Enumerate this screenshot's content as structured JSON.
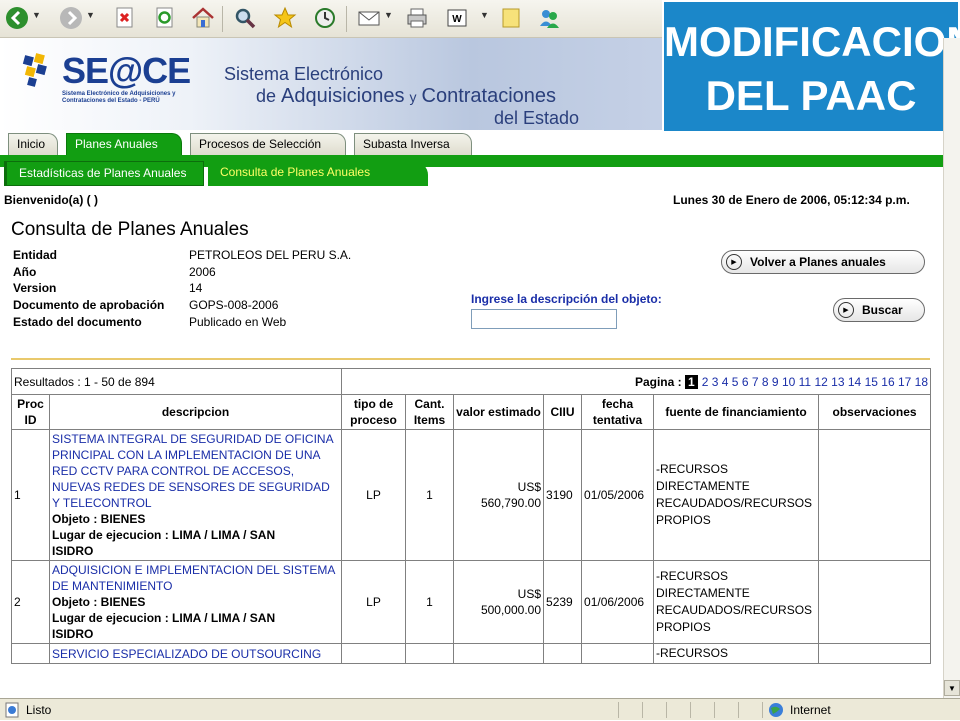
{
  "toolbar": {
    "buttons": [
      "back-icon",
      "forward-icon",
      "stop-icon",
      "refresh-icon",
      "home-icon",
      "search-icon",
      "favorites-icon",
      "history-icon",
      "mail-icon",
      "print-icon",
      "edit-icon",
      "discuss-icon",
      "messenger-icon"
    ]
  },
  "banner": {
    "logo": "SE@CE",
    "logo_sub": "Sistema Electrónico de Adquisiciones y Contrataciones del Estado - PERÚ",
    "title_line1": "Sistema Electrónico",
    "title_line2a": "de",
    "title_line2b": "Adquisiciones",
    "title_line2c": "y",
    "title_line2d": "Contrataciones",
    "title_line3": "del Estado"
  },
  "overlay": {
    "line1": "MODIFICACION",
    "line2": "DEL PAAC"
  },
  "tabs": [
    "Inicio",
    "Planes Anuales",
    "Procesos de Selección",
    "Subasta Inversa"
  ],
  "subtabs": [
    "Estadísticas de Planes Anuales",
    "Consulta de Planes Anuales"
  ],
  "welcome": "Bienvenido(a) ( )",
  "datetime": "Lunes 30 de Enero de 2006, 05:12:34 p.m.",
  "page_title": "Consulta de Planes Anuales",
  "info": {
    "entidad_label": "Entidad",
    "entidad": "PETROLEOS DEL PERU S.A.",
    "anio_label": "Año",
    "anio": "2006",
    "version_label": "Version",
    "version": "14",
    "doc_label": "Documento de aprobación",
    "doc": "GOPS-008-2006",
    "estado_label": "Estado del documento",
    "estado": "Publicado en Web"
  },
  "buttons": {
    "volver": "Volver a Planes anuales",
    "buscar": "Buscar"
  },
  "search": {
    "label": "Ingrese la descripción del objeto:",
    "value": ""
  },
  "results": {
    "summary": "Resultados : 1 - 50 de 894",
    "pager_label": "Pagina :",
    "current_page": "1",
    "pages": [
      "2",
      "3",
      "4",
      "5",
      "6",
      "7",
      "8",
      "9",
      "10",
      "11",
      "12",
      "13",
      "14",
      "15",
      "16",
      "17",
      "18"
    ],
    "headers": {
      "proc": "Proc ID",
      "descripcion": "descripcion",
      "tipo": "tipo de proceso",
      "cant": "Cant. Items",
      "valor": "valor estimado",
      "ciiu": "CIIU",
      "fecha": "fecha tentativa",
      "fuente": "fuente de financiamiento",
      "obs": "observaciones"
    },
    "rows": [
      {
        "id": "1",
        "desc_lines": [
          "SISTEMA INTEGRAL DE SEGURIDAD DE OFICINA",
          "PRINCIPAL CON LA IMPLEMENTACION DE UNA",
          "RED CCTV PARA CONTROL DE ACCESOS,",
          "NUEVAS REDES DE SENSORES DE SEGURIDAD",
          "Y TELECONTROL"
        ],
        "objeto": "Objeto : BIENES",
        "lugar_lines": [
          "Lugar de ejecucion : LIMA / LIMA / SAN",
          "ISIDRO"
        ],
        "tipo": "LP",
        "cant": "1",
        "valor_line1": "US$",
        "valor_line2": "560,790.00",
        "ciiu": "3190",
        "fecha": "01/05/2006",
        "fuente_lines": [
          "-RECURSOS",
          "DIRECTAMENTE",
          "RECAUDADOS/RECURSOS",
          "PROPIOS"
        ],
        "obs": ""
      },
      {
        "id": "2",
        "desc_lines": [
          "ADQUISICION E IMPLEMENTACION DEL SISTEMA",
          "DE MANTENIMIENTO"
        ],
        "objeto": "Objeto : BIENES",
        "lugar_lines": [
          "Lugar de ejecucion : LIMA / LIMA / SAN",
          "ISIDRO"
        ],
        "tipo": "LP",
        "cant": "1",
        "valor_line1": "US$",
        "valor_line2": "500,000.00",
        "ciiu": "5239",
        "fecha": "01/06/2006",
        "fuente_lines": [
          "-RECURSOS",
          "DIRECTAMENTE",
          "RECAUDADOS/RECURSOS",
          "PROPIOS"
        ],
        "obs": ""
      },
      {
        "id": "",
        "desc_lines": [
          "SERVICIO ESPECIALIZADO DE OUTSOURCING"
        ],
        "fuente_lines": [
          "-RECURSOS"
        ]
      }
    ]
  },
  "status": {
    "left": "Listo",
    "zone": "Internet"
  }
}
